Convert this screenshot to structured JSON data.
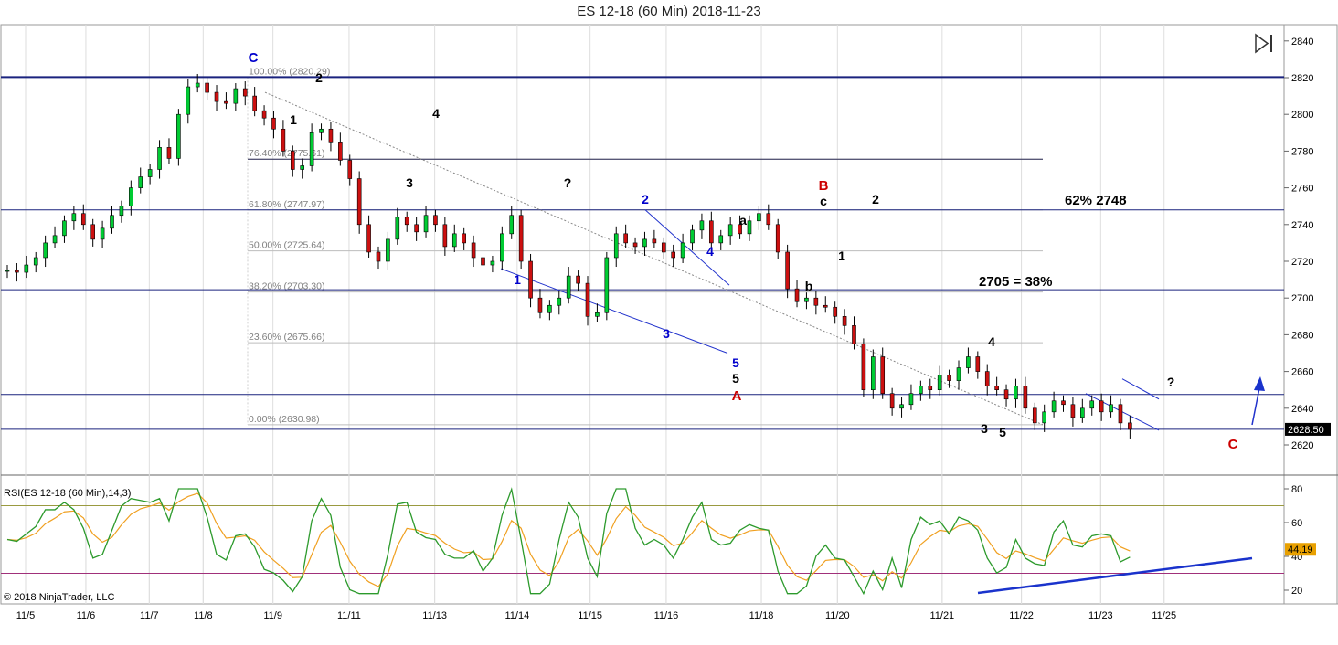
{
  "title": "ES 12-18 (60 Min)  2018-11-23",
  "copyright": "© 2018 NinjaTrader, LLC",
  "price_badge": "2628.50",
  "rsi_badge": "44.19",
  "rsi_label": "RSI(ES 12-18 (60 Min),14,3)",
  "chart_data": [
    {
      "type": "candlestick",
      "x_ticks": [
        "11/5",
        "11/6",
        "11/7",
        "11/8",
        "11/9",
        "11/11",
        "11/13",
        "11/14",
        "11/15",
        "11/16",
        "11/18",
        "11/20",
        "11/21",
        "11/22",
        "11/23",
        "11/25"
      ],
      "y_ticks": [
        2620,
        2640,
        2660,
        2680,
        2700,
        2720,
        2740,
        2760,
        2780,
        2800,
        2820,
        2840
      ],
      "ylim": [
        2610,
        2847
      ],
      "last_price": 2628.5,
      "price_path": [
        [
          0,
          2715
        ],
        [
          0.3,
          2714
        ],
        [
          0.6,
          2718
        ],
        [
          0.9,
          2722
        ],
        [
          1.2,
          2730
        ],
        [
          1.5,
          2734
        ],
        [
          1.8,
          2742
        ],
        [
          2.1,
          2746
        ],
        [
          2.4,
          2740
        ],
        [
          2.7,
          2732
        ],
        [
          3.0,
          2738
        ],
        [
          3.3,
          2745
        ],
        [
          3.6,
          2750
        ],
        [
          3.9,
          2760
        ],
        [
          4.2,
          2766
        ],
        [
          4.5,
          2770
        ],
        [
          4.8,
          2782
        ],
        [
          5.1,
          2776
        ],
        [
          5.4,
          2800
        ],
        [
          5.7,
          2815
        ],
        [
          6.0,
          2817
        ],
        [
          6.3,
          2812
        ],
        [
          6.6,
          2807
        ],
        [
          6.9,
          2806
        ],
        [
          7.2,
          2814
        ],
        [
          7.5,
          2810
        ],
        [
          7.8,
          2802
        ],
        [
          8.1,
          2798
        ],
        [
          8.4,
          2792
        ],
        [
          8.7,
          2780
        ],
        [
          9.0,
          2770
        ],
        [
          9.3,
          2772
        ],
        [
          9.6,
          2790
        ],
        [
          9.9,
          2792
        ],
        [
          10.2,
          2785
        ],
        [
          10.5,
          2775
        ],
        [
          10.8,
          2765
        ],
        [
          11.1,
          2740
        ],
        [
          11.4,
          2725
        ],
        [
          11.7,
          2720
        ],
        [
          12.0,
          2732
        ],
        [
          12.3,
          2744
        ],
        [
          12.6,
          2740
        ],
        [
          12.9,
          2736
        ],
        [
          13.2,
          2745
        ],
        [
          13.5,
          2740
        ],
        [
          13.8,
          2728
        ],
        [
          14.1,
          2735
        ],
        [
          14.4,
          2730
        ],
        [
          14.7,
          2722
        ],
        [
          15.0,
          2718
        ],
        [
          15.3,
          2720
        ],
        [
          15.6,
          2735
        ],
        [
          15.9,
          2745
        ],
        [
          16.2,
          2720
        ],
        [
          16.5,
          2700
        ],
        [
          16.8,
          2692
        ],
        [
          17.1,
          2696
        ],
        [
          17.4,
          2700
        ],
        [
          17.7,
          2712
        ],
        [
          18.0,
          2708
        ],
        [
          18.3,
          2690
        ],
        [
          18.6,
          2692
        ],
        [
          18.9,
          2722
        ],
        [
          19.2,
          2735
        ],
        [
          19.5,
          2730
        ],
        [
          19.8,
          2728
        ],
        [
          20.1,
          2732
        ],
        [
          20.4,
          2730
        ],
        [
          20.7,
          2725
        ],
        [
          21.0,
          2722
        ],
        [
          21.3,
          2730
        ],
        [
          21.6,
          2737
        ],
        [
          21.9,
          2742
        ],
        [
          22.2,
          2730
        ],
        [
          22.5,
          2734
        ],
        [
          22.8,
          2740
        ],
        [
          23.1,
          2735
        ],
        [
          23.4,
          2742
        ],
        [
          23.7,
          2746
        ],
        [
          24.0,
          2740
        ],
        [
          24.3,
          2725
        ],
        [
          24.6,
          2705
        ],
        [
          24.9,
          2698
        ],
        [
          25.2,
          2700
        ],
        [
          25.5,
          2696
        ],
        [
          25.8,
          2695
        ],
        [
          26.1,
          2690
        ],
        [
          26.4,
          2685
        ],
        [
          26.7,
          2675
        ],
        [
          27.0,
          2650
        ],
        [
          27.3,
          2668
        ],
        [
          27.6,
          2648
        ],
        [
          27.9,
          2640
        ],
        [
          28.2,
          2642
        ],
        [
          28.5,
          2648
        ],
        [
          28.8,
          2652
        ],
        [
          29.1,
          2650
        ],
        [
          29.4,
          2658
        ],
        [
          29.7,
          2655
        ],
        [
          30.0,
          2662
        ],
        [
          30.3,
          2668
        ],
        [
          30.6,
          2660
        ],
        [
          30.9,
          2652
        ],
        [
          31.2,
          2650
        ],
        [
          31.5,
          2645
        ],
        [
          31.8,
          2652
        ],
        [
          32.1,
          2640
        ],
        [
          32.4,
          2632
        ],
        [
          32.7,
          2638
        ],
        [
          33.0,
          2644
        ],
        [
          33.3,
          2642
        ],
        [
          33.6,
          2635
        ],
        [
          33.9,
          2640
        ],
        [
          34.2,
          2644
        ],
        [
          34.5,
          2638
        ],
        [
          34.8,
          2642
        ],
        [
          35.1,
          2632
        ],
        [
          35.4,
          2628.5
        ]
      ],
      "horizontal_lines": [
        2820.29,
        2775.61,
        2747.97,
        2704.5,
        2647.5,
        2628.5
      ],
      "fib_labels": [
        "100.00% (2820.29)",
        "76.40% (2775.61)",
        "61.80% (2747.97)",
        "50.00% (2725.64)",
        "38.20% (2703.30)",
        "23.60% (2675.66)",
        "0.00% (2630.98)"
      ],
      "fib_values": [
        2820.29,
        2775.61,
        2747.97,
        2725.64,
        2703.3,
        2675.66,
        2630.98
      ],
      "annotations": [
        "62% 2748",
        "2705 = 38%"
      ],
      "wave_labels": [
        "C",
        "1",
        "2",
        "3",
        "4",
        "?",
        "1",
        "2",
        "3",
        "4",
        "5",
        "5",
        "A",
        "a",
        "b",
        "c",
        "B",
        "1",
        "2",
        "3",
        "4",
        "5",
        "?",
        "C"
      ]
    },
    {
      "type": "line",
      "name": "RSI",
      "y_ticks": [
        20,
        40,
        60,
        80
      ],
      "ylim": [
        12,
        86
      ],
      "reference_lines": [
        70,
        30
      ],
      "last_value": 44.19
    }
  ]
}
